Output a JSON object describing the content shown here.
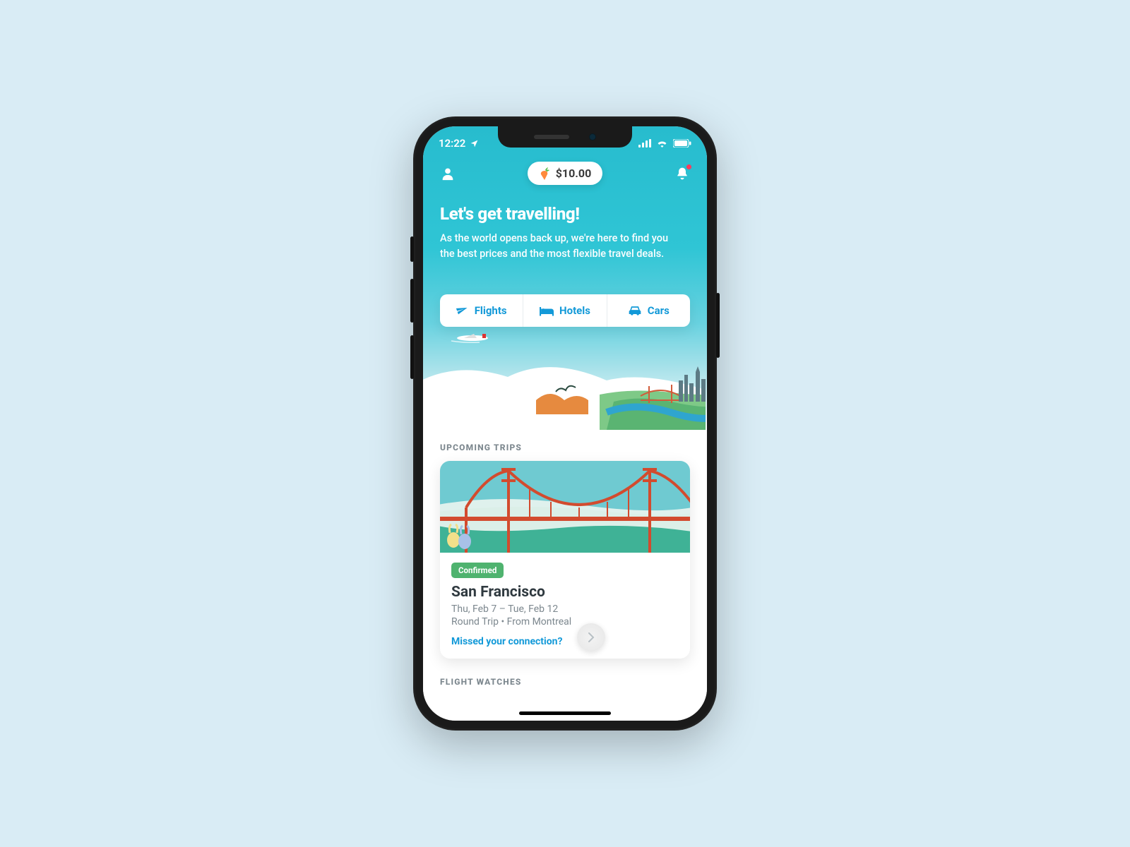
{
  "status": {
    "time": "12:22"
  },
  "wallet": {
    "amount": "$10.00"
  },
  "hero": {
    "title": "Let's get travelling!",
    "subtitle": "As the world opens back up, we're here to find you the best prices and the most flexible travel deals."
  },
  "categories": [
    {
      "label": "Flights"
    },
    {
      "label": "Hotels"
    },
    {
      "label": "Cars"
    }
  ],
  "sections": {
    "upcoming": "UPCOMING TRIPS",
    "watches": "FLIGHT WATCHES"
  },
  "trip": {
    "status": "Confirmed",
    "destination": "San Francisco",
    "dates": "Thu, Feb 7 – Tue, Feb 12",
    "detail": "Round Trip • From Montreal",
    "link": "Missed your connection?"
  }
}
